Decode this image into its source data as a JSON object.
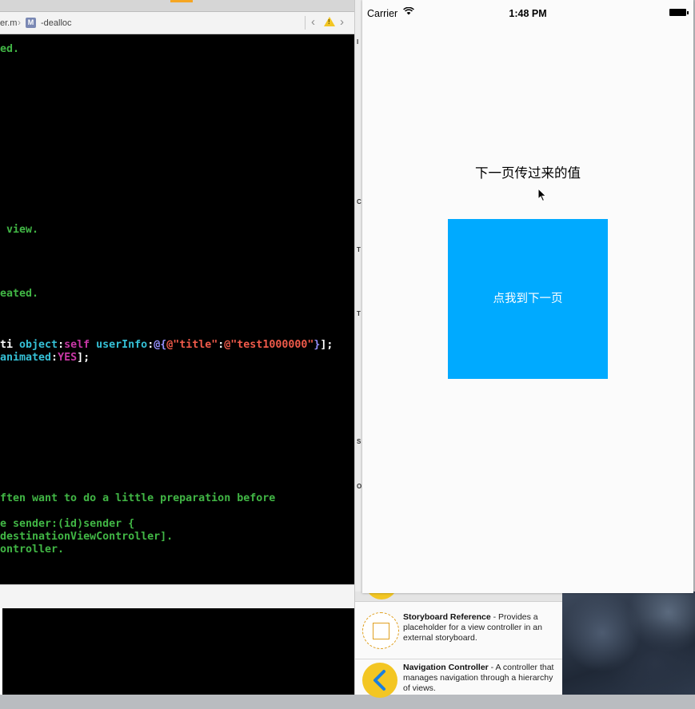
{
  "xcode": {
    "jumpbar": {
      "file": "er.m",
      "method_badge": "M",
      "method": "-dealloc",
      "warning_glyph": "!"
    },
    "code_lines": [
      [
        {
          "t": "ed.",
          "c": "cm"
        }
      ],
      [
        {
          "t": " view.",
          "c": "cm"
        }
      ],
      [
        {
          "t": "eated.",
          "c": "cm"
        }
      ],
      [
        {
          "t": "ti ",
          "c": "pl"
        },
        {
          "t": "object",
          "c": "fn"
        },
        {
          "t": ":",
          "c": "pl"
        },
        {
          "t": "self",
          "c": "kw"
        },
        {
          "t": " ",
          "c": "pl"
        },
        {
          "t": "userInfo",
          "c": "fn"
        },
        {
          "t": ":",
          "c": "pl"
        },
        {
          "t": "@{",
          "c": "at"
        },
        {
          "t": "@\"title\"",
          "c": "st"
        },
        {
          "t": ":",
          "c": "pl"
        },
        {
          "t": "@\"test1000000\"",
          "c": "st"
        },
        {
          "t": "}",
          "c": "at"
        },
        {
          "t": "];",
          "c": "pl"
        }
      ],
      [
        {
          "t": "animated",
          "c": "fn"
        },
        {
          "t": ":",
          "c": "pl"
        },
        {
          "t": "YES",
          "c": "kw"
        },
        {
          "t": "];",
          "c": "pl"
        }
      ],
      [
        {
          "t": "ften want to do a little preparation before",
          "c": "cm"
        }
      ],
      [
        {
          "t": "e sender:(id)sender {",
          "c": "cm"
        }
      ],
      [
        {
          "t": "destinationViewController].",
          "c": "cm"
        }
      ],
      [
        {
          "t": "ontroller.",
          "c": "cm"
        }
      ]
    ]
  },
  "inspector": {
    "letters": [
      "I",
      "C",
      "T",
      "T",
      "S",
      "O"
    ]
  },
  "library": {
    "items": [
      {
        "title": "Storyboard Reference",
        "desc": " - Provides a placeholder for a view controller in an external storyboard."
      },
      {
        "title": "Navigation Controller",
        "desc": " - A controller that manages navigation through a hierarchy of views."
      }
    ]
  },
  "simulator": {
    "carrier": "Carrier",
    "time": "1:48 PM",
    "value_label": "下一页传过来的值",
    "button_label": "点我到下一页",
    "button_color": "#00aaff"
  }
}
